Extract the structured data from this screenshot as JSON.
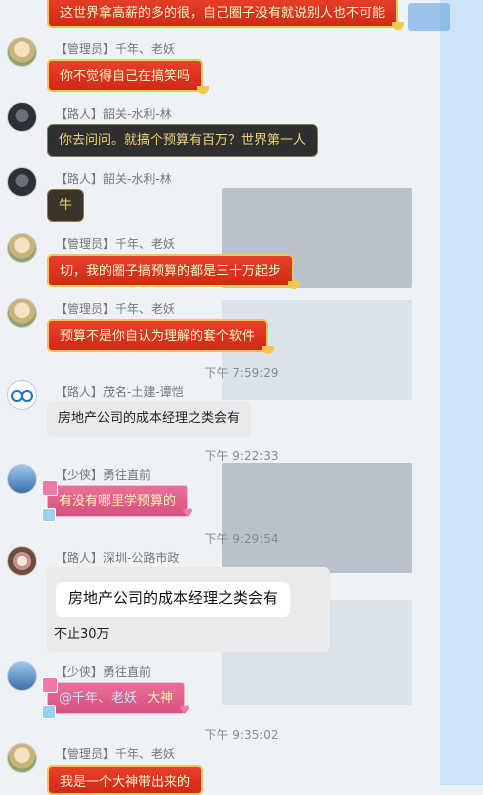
{
  "colors": {
    "red_bubble": "#d93420",
    "dark_bubble": "#2f2f2f",
    "gray_bubble": "#e9eaec",
    "pink_bubble": "#e0628e"
  },
  "messages": [
    {
      "id": "m0",
      "text": "这世界拿高薪的多的很，自己圈子没有就说别人也不可能"
    },
    {
      "id": "m1",
      "sender": "【管理员】千年、老妖",
      "text": "你不觉得自己在搞笑吗"
    },
    {
      "id": "m2",
      "sender": "【路人】韶关-水利-林",
      "text": "你去问问。就搞个预算有百万？世界第一人"
    },
    {
      "id": "m3",
      "sender": "【路人】韶关-水利-林",
      "text": "牛"
    },
    {
      "id": "m4",
      "sender": "【管理员】千年、老妖",
      "text": "切，我的圈子搞预算的都是三十万起步"
    },
    {
      "id": "m5",
      "sender": "【管理员】千年、老妖",
      "text": "预算不是你自认为理解的套个软件"
    },
    {
      "id": "t1",
      "time": "下午 7:59:29"
    },
    {
      "id": "m6",
      "sender": "【路人】茂名-土建-谭恺",
      "text": "房地产公司的成本经理之类会有"
    },
    {
      "id": "t2",
      "time": "下午 9:22:33"
    },
    {
      "id": "m7",
      "sender": "【少侠】勇往直前",
      "text": "有没有哪里学预算的"
    },
    {
      "id": "t3",
      "time": "下午 9:29:54"
    },
    {
      "id": "m8",
      "sender": "【路人】深圳-公路市政",
      "quote": "房地产公司的成本经理之类会有",
      "text": "不止30万"
    },
    {
      "id": "m9",
      "sender": "【少侠】勇往直前",
      "mention": "@千年、老妖",
      "text": "大神"
    },
    {
      "id": "t4",
      "time": "下午 9:35:02"
    },
    {
      "id": "m10",
      "sender": "【管理员】千年、老妖",
      "text": "我是一个大神带出来的"
    }
  ]
}
